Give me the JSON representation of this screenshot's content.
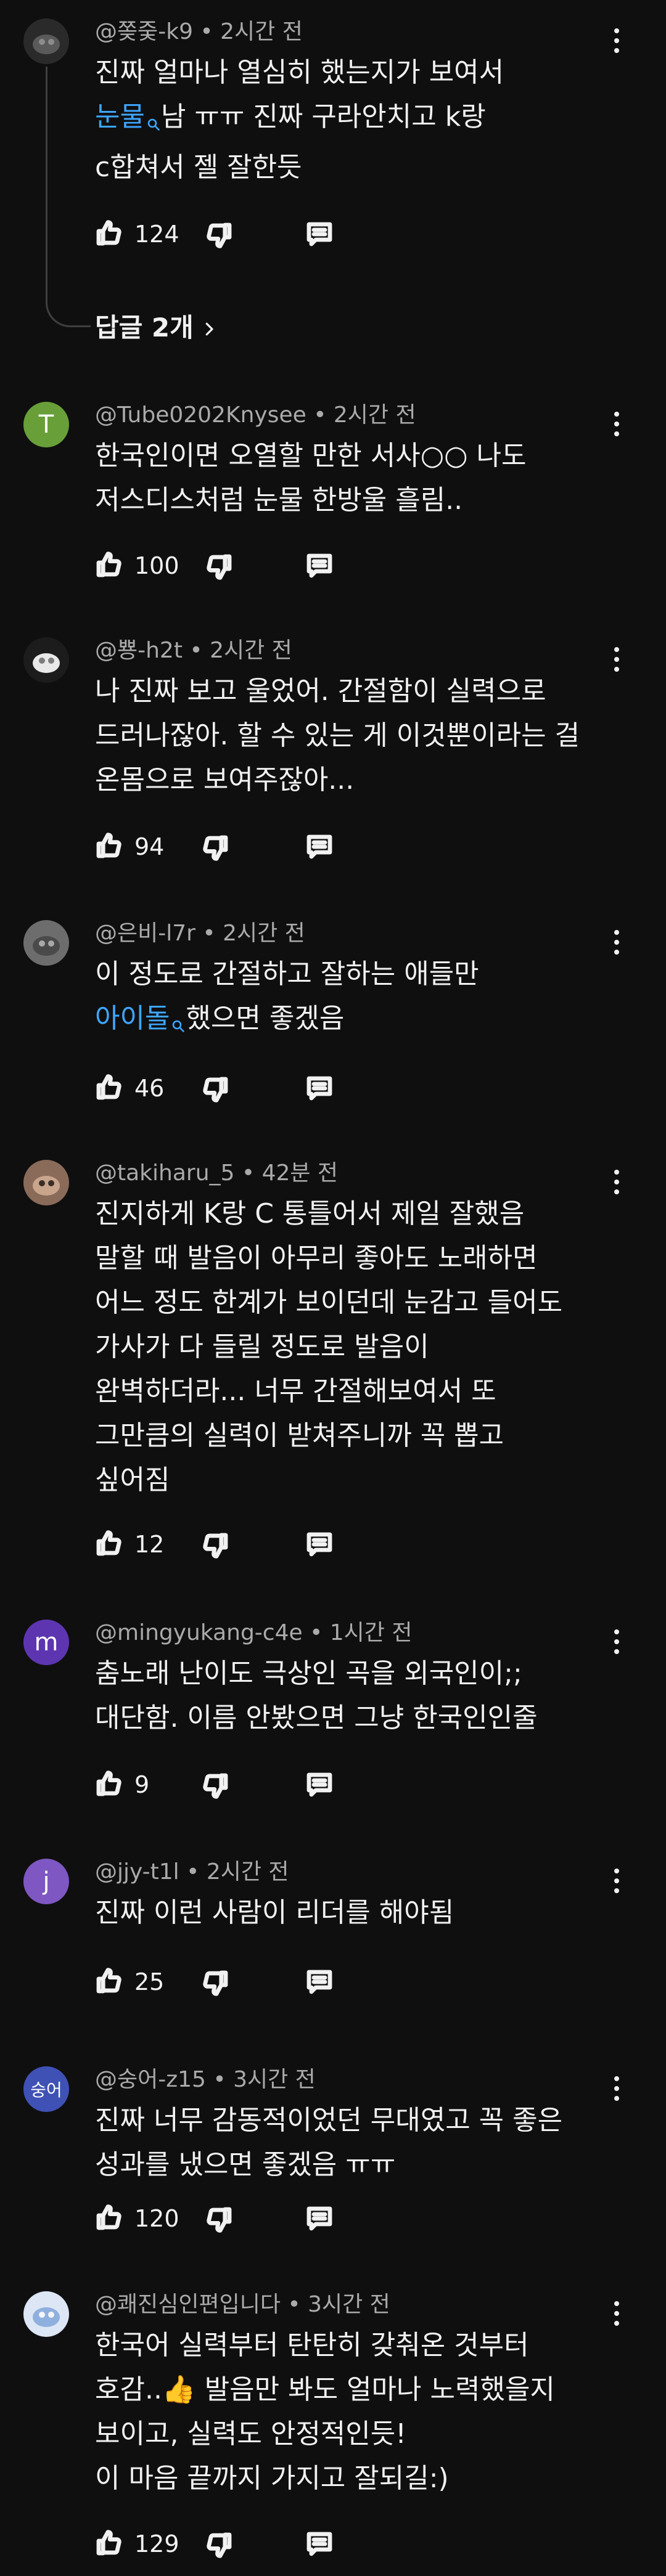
{
  "comments": [
    {
      "author": "@쫒줒-k9",
      "time": "2시간 전",
      "lines": [
        {
          "parts": [
            {
              "t": "진짜 얼마나 열심히 했는지가 보여서"
            }
          ]
        },
        {
          "parts": [
            {
              "t": "눈물",
              "link": true
            },
            {
              "t": "남 ㅠㅠ 진짜 구라안치고 k랑"
            }
          ]
        },
        {
          "parts": [
            {
              "t": "c합쳐서 젤 잘한듯"
            }
          ]
        }
      ],
      "likes": "124",
      "replies_label": "답글 2개",
      "avatar": {
        "kind": "photo"
      }
    },
    {
      "author": "@Tube0202Knysee",
      "time": "2시간 전",
      "lines": [
        {
          "parts": [
            {
              "t": "한국인이면 오열할 만한 서사○○ 나도"
            }
          ]
        },
        {
          "parts": [
            {
              "t": "저스디스처럼 눈물 한방울 흘림.."
            }
          ]
        }
      ],
      "likes": "100",
      "avatar": {
        "kind": "letter",
        "letter": "T",
        "color": "#689f38"
      }
    },
    {
      "author": "@뿅-h2t",
      "time": "2시간 전",
      "lines": [
        {
          "parts": [
            {
              "t": "나 진짜 보고 울었어. 간절함이 실력으로"
            }
          ]
        },
        {
          "parts": [
            {
              "t": "드러나잖아. 할 수 있는 게 이것뿐이라는 걸"
            }
          ]
        },
        {
          "parts": [
            {
              "t": "온몸으로 보여주잖아..."
            }
          ]
        }
      ],
      "likes": "94",
      "avatar": {
        "kind": "photo"
      }
    },
    {
      "author": "@은비-l7r",
      "time": "2시간 전",
      "lines": [
        {
          "parts": [
            {
              "t": "이 정도로 간절하고 잘하는 애들만"
            }
          ]
        },
        {
          "parts": [
            {
              "t": "아이돌",
              "link": true
            },
            {
              "t": "했으면 좋겠음"
            }
          ]
        }
      ],
      "likes": "46",
      "avatar": {
        "kind": "photo"
      }
    },
    {
      "author": "@takiharu_5",
      "time": "42분 전",
      "lines": [
        {
          "parts": [
            {
              "t": "진지하게 K랑 C 통틀어서 제일 잘했음"
            }
          ]
        },
        {
          "parts": [
            {
              "t": "말할 때 발음이 아무리 좋아도 노래하면"
            }
          ]
        },
        {
          "parts": [
            {
              "t": "어느 정도 한계가 보이던데 눈감고 들어도"
            }
          ]
        },
        {
          "parts": [
            {
              "t": "가사가 다 들릴 정도로 발음이"
            }
          ]
        },
        {
          "parts": [
            {
              "t": "완벽하더라... 너무 간절해보여서 또"
            }
          ]
        },
        {
          "parts": [
            {
              "t": "그만큼의 실력이 받쳐주니까 꼭 뽑고"
            }
          ]
        },
        {
          "parts": [
            {
              "t": "싶어짐"
            }
          ]
        }
      ],
      "likes": "12",
      "avatar": {
        "kind": "photo"
      }
    },
    {
      "author": "@mingyukang-c4e",
      "time": "1시간 전",
      "lines": [
        {
          "parts": [
            {
              "t": "춤노래 난이도 극상인 곡을 외국인이;;"
            }
          ]
        },
        {
          "parts": [
            {
              "t": "대단함. 이름 안봤으면 그냥 한국인인줄"
            }
          ]
        }
      ],
      "likes": "9",
      "avatar": {
        "kind": "letter",
        "letter": "m",
        "color": "#5e35b1"
      }
    },
    {
      "author": "@jjy-t1l",
      "time": "2시간 전",
      "lines": [
        {
          "parts": [
            {
              "t": "진짜 이런 사람이 리더를 해야됨"
            }
          ]
        }
      ],
      "likes": "25",
      "avatar": {
        "kind": "letter",
        "letter": "j",
        "color": "#7e57c2"
      }
    },
    {
      "author": "@숭어-z15",
      "time": "3시간 전",
      "lines": [
        {
          "parts": [
            {
              "t": "진짜 너무 감동적이었던 무대였고 꼭 좋은"
            }
          ]
        },
        {
          "parts": [
            {
              "t": "성과를 냈으면 좋겠음 ㅠㅠ"
            }
          ]
        }
      ],
      "likes": "120",
      "avatar": {
        "kind": "letter",
        "letter": "숭어",
        "color": "#3f51b5"
      }
    },
    {
      "author": "@쾌진심인편입니다",
      "time": "3시간 전",
      "lines": [
        {
          "parts": [
            {
              "t": "한국어 실력부터 탄탄히 갖춰온 것부터"
            }
          ]
        },
        {
          "parts": [
            {
              "t": "호감..👍 발음만 봐도 얼마나 노력했을지"
            }
          ]
        },
        {
          "parts": [
            {
              "t": "보이고, 실력도 안정적인듯!"
            }
          ]
        },
        {
          "parts": [
            {
              "t": "이 마음 끝까지 가지고 잘되길:)"
            }
          ]
        }
      ],
      "likes": "129",
      "avatar": {
        "kind": "photo"
      }
    }
  ],
  "icons": {
    "like": "thumbs-up-icon",
    "dislike": "thumbs-down-icon",
    "reply": "reply-icon",
    "menu": "more-vertical-icon",
    "search_link": "search-icon"
  },
  "colors": {
    "background": "#0f0f0f",
    "text": "#f1f1f1",
    "meta": "#aaaaaa",
    "link": "#3ea6ff"
  }
}
